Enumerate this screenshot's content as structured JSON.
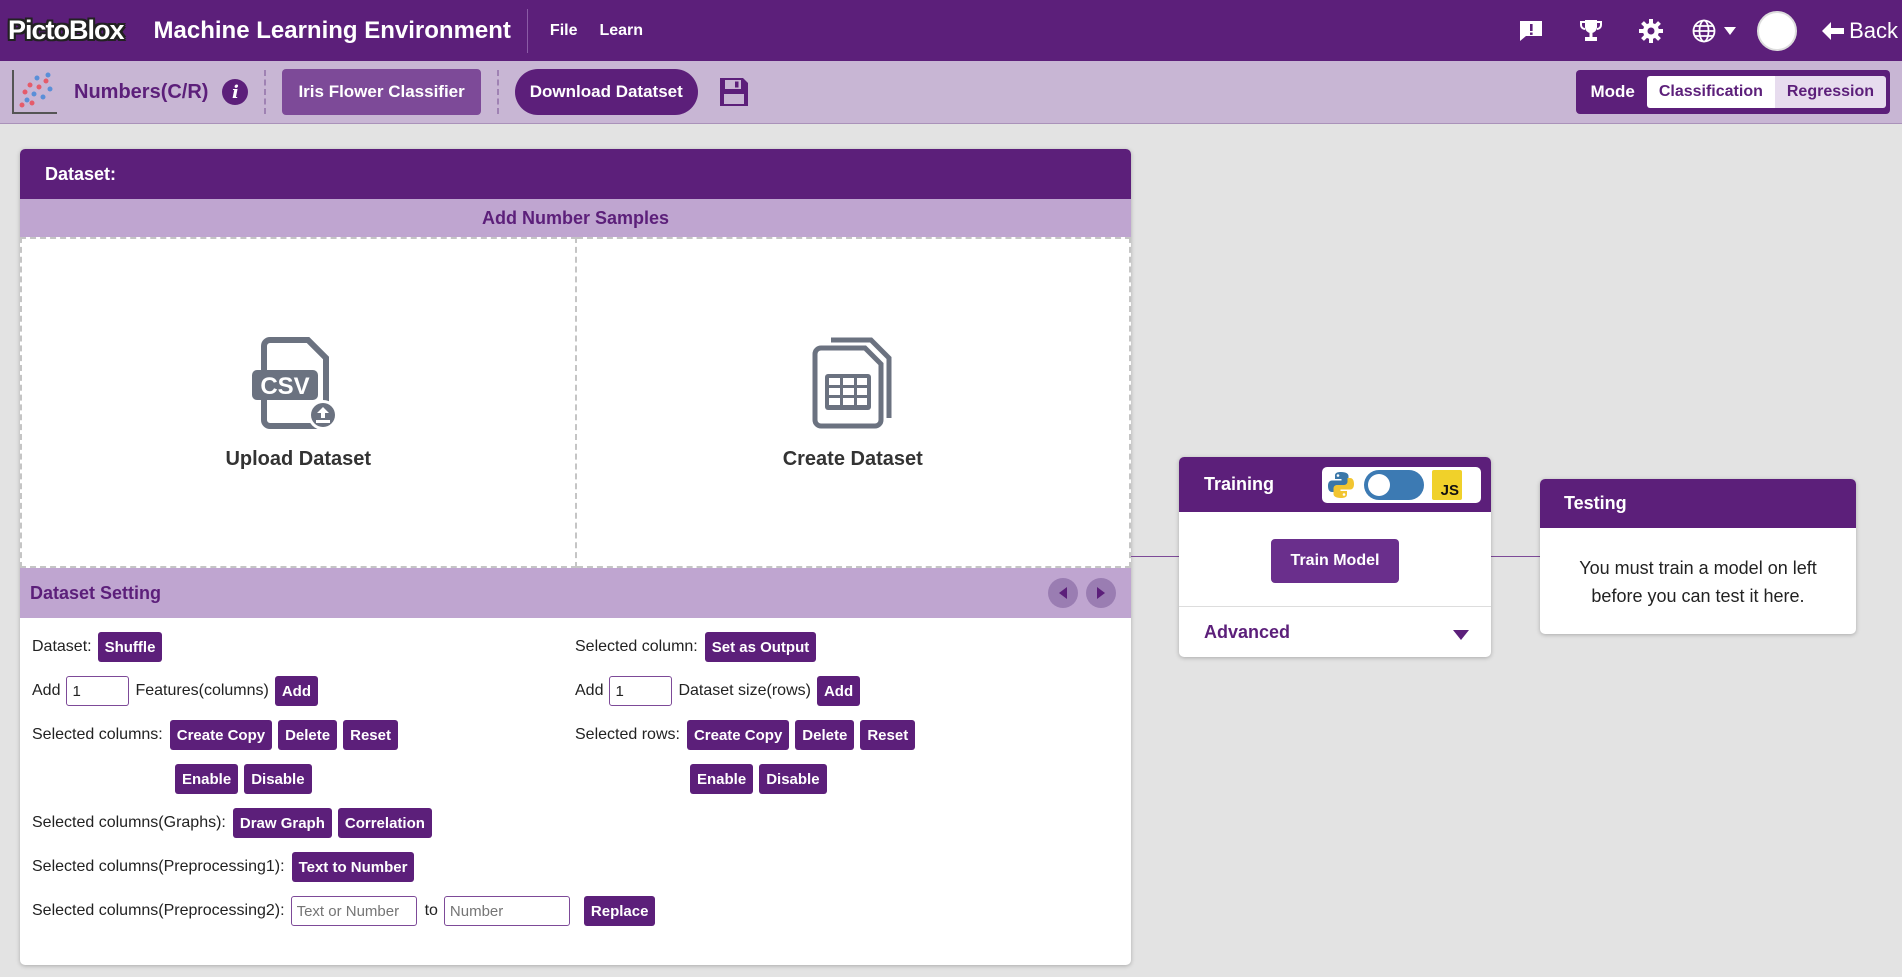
{
  "app": {
    "logo": "PictoBlox",
    "title": "Machine Learning Environment",
    "menu": [
      "File",
      "Learn"
    ],
    "back_label": "Back"
  },
  "toolbar": {
    "dataset_type": "Numbers(C/R)",
    "project_name": "Iris Flower Classifier",
    "download_label": "Download Datatset",
    "mode_label": "Mode",
    "modes": [
      "Classification",
      "Regression"
    ],
    "active_mode": "Classification"
  },
  "dataset": {
    "header": "Dataset:",
    "add_samples": "Add Number Samples",
    "upload_label": "Upload Dataset",
    "create_label": "Create Dataset",
    "csv_text": "CSV"
  },
  "settings": {
    "title": "Dataset Setting",
    "dataset_label": "Dataset:",
    "shuffle": "Shuffle",
    "add_label": "Add",
    "features_value": "1",
    "features_label": "Features(columns)",
    "add_btn": "Add",
    "selected_columns_label": "Selected columns:",
    "create_copy": "Create Copy",
    "delete": "Delete",
    "reset": "Reset",
    "enable": "Enable",
    "disable": "Disable",
    "graphs_label": "Selected columns(Graphs):",
    "draw_graph": "Draw Graph",
    "correlation": "Correlation",
    "pre1_label": "Selected columns(Preprocessing1):",
    "text_to_number": "Text to Number",
    "pre2_label": "Selected columns(Preprocessing2):",
    "from_placeholder": "Text or Number",
    "to_label": "to",
    "to_placeholder": "Number",
    "replace": "Replace",
    "selected_column_label": "Selected column:",
    "set_as_output": "Set as Output",
    "rows_value": "1",
    "rows_label": "Dataset size(rows)",
    "selected_rows_label": "Selected rows:"
  },
  "training": {
    "title": "Training",
    "train_btn": "Train Model",
    "advanced": "Advanced",
    "js_badge": "JS"
  },
  "testing": {
    "title": "Testing",
    "message": "You must train a model on left before you can test it here."
  },
  "colors": {
    "primary": "#5c1f7a",
    "light": "#bfa5d0",
    "toolbar_bg": "#c8b6d4"
  },
  "icons": [
    "feedback-icon",
    "trophy-icon",
    "gear-icon",
    "globe-icon",
    "avatar",
    "back-arrow-icon",
    "info-icon",
    "save-icon",
    "csv-upload-icon",
    "table-icon",
    "python-icon",
    "js-icon"
  ]
}
